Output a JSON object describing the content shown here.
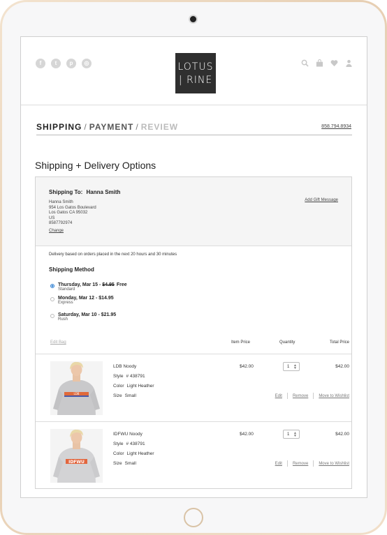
{
  "header": {
    "logo_line1": "LOTUS",
    "logo_line2": "| RINE",
    "social_icons": [
      "facebook-icon",
      "twitter-icon",
      "pinterest-icon",
      "instagram-icon"
    ],
    "utility_icons": [
      "search-icon",
      "bag-icon",
      "heart-icon",
      "user-icon"
    ]
  },
  "steps": {
    "shipping": "SHIPPING",
    "payment": "PAYMENT",
    "review": "REVIEW",
    "separator": "/",
    "phone": "858.794.8934"
  },
  "page_title": "Shipping + Delivery Options",
  "shipping_to": {
    "label": "Shipping To:",
    "name": "Hanna Smith",
    "address": [
      "Hanna Smith",
      "954 Los Gatos Boulevard",
      "Los Gatos CA 95032",
      "US",
      "8587792974"
    ],
    "change": "Change",
    "gift_message": "Add Gift Message"
  },
  "delivery_note": "Delivery based on orders placed in the next 20 hours and 30 minutes",
  "shipping_method": {
    "title": "Shipping Method",
    "options": [
      {
        "date": "Thursday, Mar 15 - ",
        "old_price": "$4.95",
        "extra": "Free",
        "label": "Standard",
        "selected": true
      },
      {
        "date": "Monday, Mar 12 - $14.95",
        "label": "Express",
        "selected": false
      },
      {
        "date": "Saturday, Mar 10 - $21.95",
        "label": "Rush",
        "selected": false
      }
    ]
  },
  "table_head": {
    "edit_bag": "Edit Bag",
    "item_price": "Item Price",
    "quantity": "Quantity",
    "total_price": "Total Price"
  },
  "items": [
    {
      "name": "LDB Noody",
      "style_label": "Style",
      "style": "# 438791",
      "color_label": "Color",
      "color": "Light Heather",
      "size_label": "Size",
      "size": "Small",
      "price": "$42.00",
      "quantity": "1",
      "total": "$42.00",
      "shirt_text": "LDB"
    },
    {
      "name": "IDFWU Noody",
      "style_label": "Style",
      "style": "# 438791",
      "color_label": "Color",
      "color": "Light Heather",
      "size_label": "Size",
      "size": "Small",
      "price": "$42.00",
      "quantity": "1",
      "total": "$42.00",
      "shirt_text": "IDFWU"
    }
  ],
  "actions": {
    "edit": "Edit",
    "remove": "Remove",
    "wishlist": "Move to Wishlist"
  },
  "colors": {
    "accent": "#2e7fd1",
    "logo_bg": "#2f2f2f",
    "frame_gold": "#e7cfb3"
  }
}
